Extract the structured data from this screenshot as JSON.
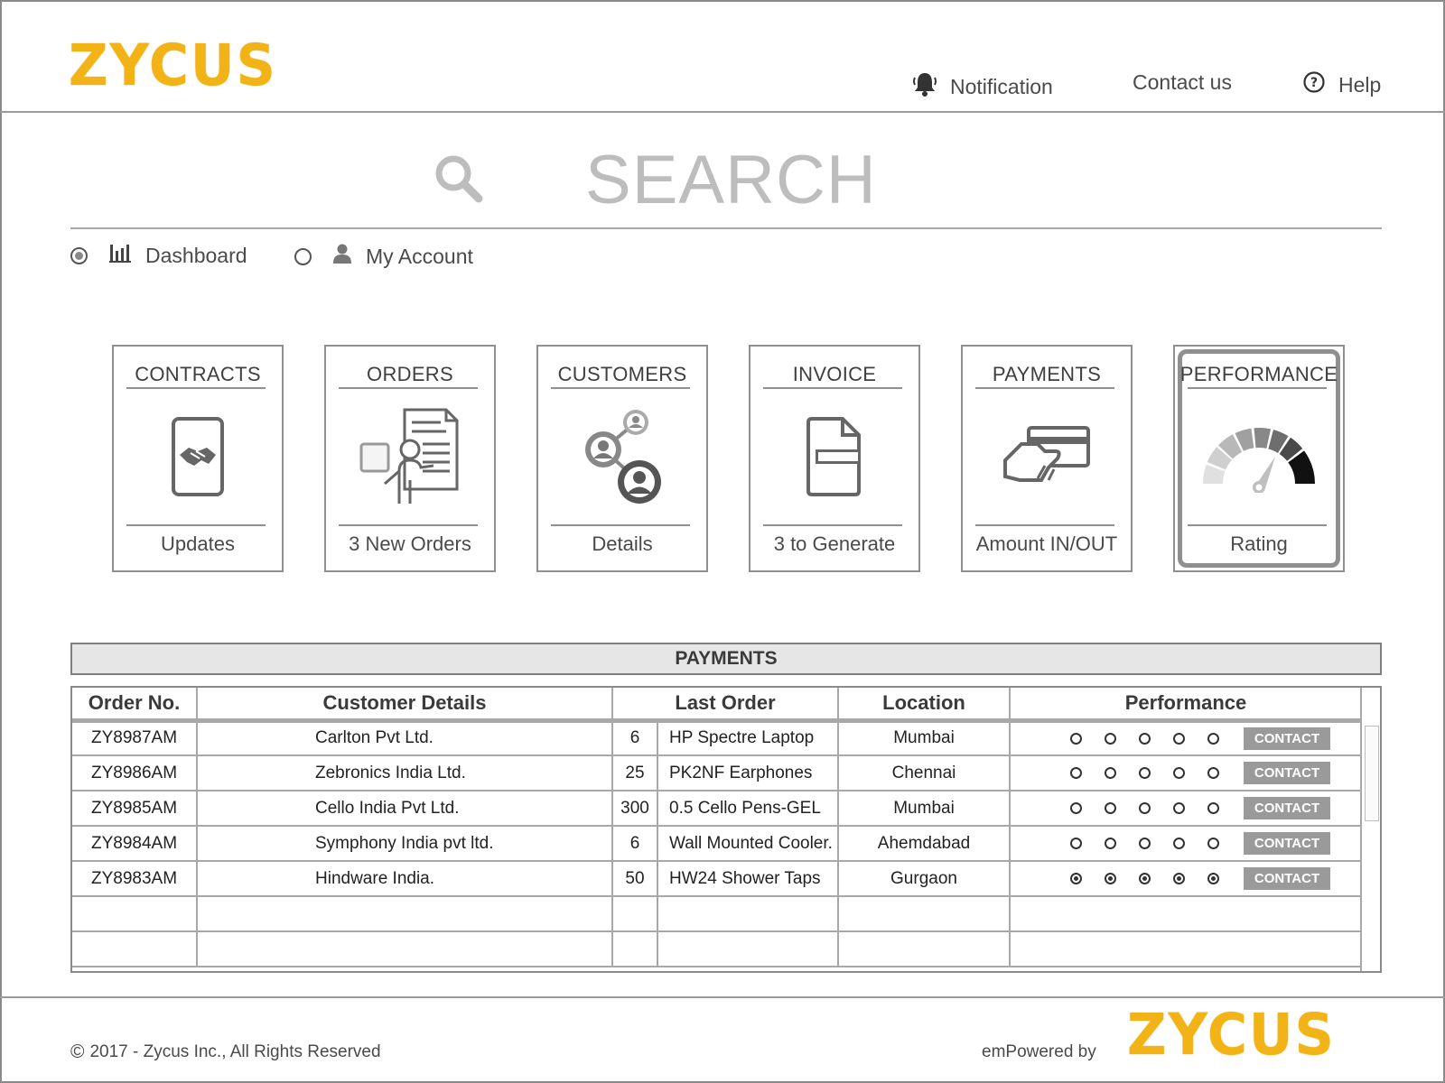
{
  "brand": {
    "logo_text": "ZYCUS",
    "accent_color": "#f2b317"
  },
  "topnav": {
    "notification": "Notification",
    "contact": "Contact us",
    "help": "Help"
  },
  "search": {
    "placeholder": "SEARCH"
  },
  "view_toggle": {
    "dashboard": {
      "label": "Dashboard",
      "selected": true,
      "icon": "bar-chart-icon"
    },
    "account": {
      "label": "My Account",
      "selected": false,
      "icon": "user-icon"
    }
  },
  "cards": [
    {
      "title": "CONTRACTS",
      "subtitle": "Updates",
      "icon": "handshake-icon"
    },
    {
      "title": "ORDERS",
      "subtitle": "3 New Orders",
      "icon": "order-document-icon"
    },
    {
      "title": "CUSTOMERS",
      "subtitle": "Details",
      "icon": "customers-network-icon"
    },
    {
      "title": "INVOICE",
      "subtitle": "3 to Generate",
      "icon": "invoice-icon"
    },
    {
      "title": "PAYMENTS",
      "subtitle": "Amount IN/OUT",
      "icon": "card-payment-icon"
    },
    {
      "title": "PERFORMANCE",
      "subtitle": "Rating",
      "icon": "gauge-icon",
      "selected": true
    }
  ],
  "payments": {
    "title": "PAYMENTS",
    "columns": [
      "Order No.",
      "Customer Details",
      "Last Order",
      "Location",
      "Performance"
    ],
    "contact_label": "CONTACT",
    "rows": [
      {
        "order": "ZY8987AM",
        "customer": "Carlton Pvt Ltd.",
        "qty": "6",
        "item": "HP Spectre Laptop",
        "location": "Mumbai",
        "rating_filled": false
      },
      {
        "order": "ZY8986AM",
        "customer": "Zebronics India Ltd.",
        "qty": "25",
        "item": "PK2NF Earphones",
        "location": "Chennai",
        "rating_filled": false
      },
      {
        "order": "ZY8985AM",
        "customer": "Cello India Pvt Ltd.",
        "qty": "300",
        "item": "0.5 Cello Pens-GEL",
        "location": "Mumbai",
        "rating_filled": false
      },
      {
        "order": "ZY8984AM",
        "customer": "Symphony India pvt ltd.",
        "qty": "6",
        "item": "Wall Mounted Cooler.",
        "location": "Ahemdabad",
        "rating_filled": false
      },
      {
        "order": "ZY8983AM",
        "customer": "Hindware India.",
        "qty": "50",
        "item": "HW24 Shower Taps",
        "location": "Gurgaon",
        "rating_filled": true
      }
    ]
  },
  "footer": {
    "copyright": "2017 - Zycus Inc., All Rights Reserved",
    "powered_by": "emPowered by",
    "logo_text": "ZYCUS"
  }
}
